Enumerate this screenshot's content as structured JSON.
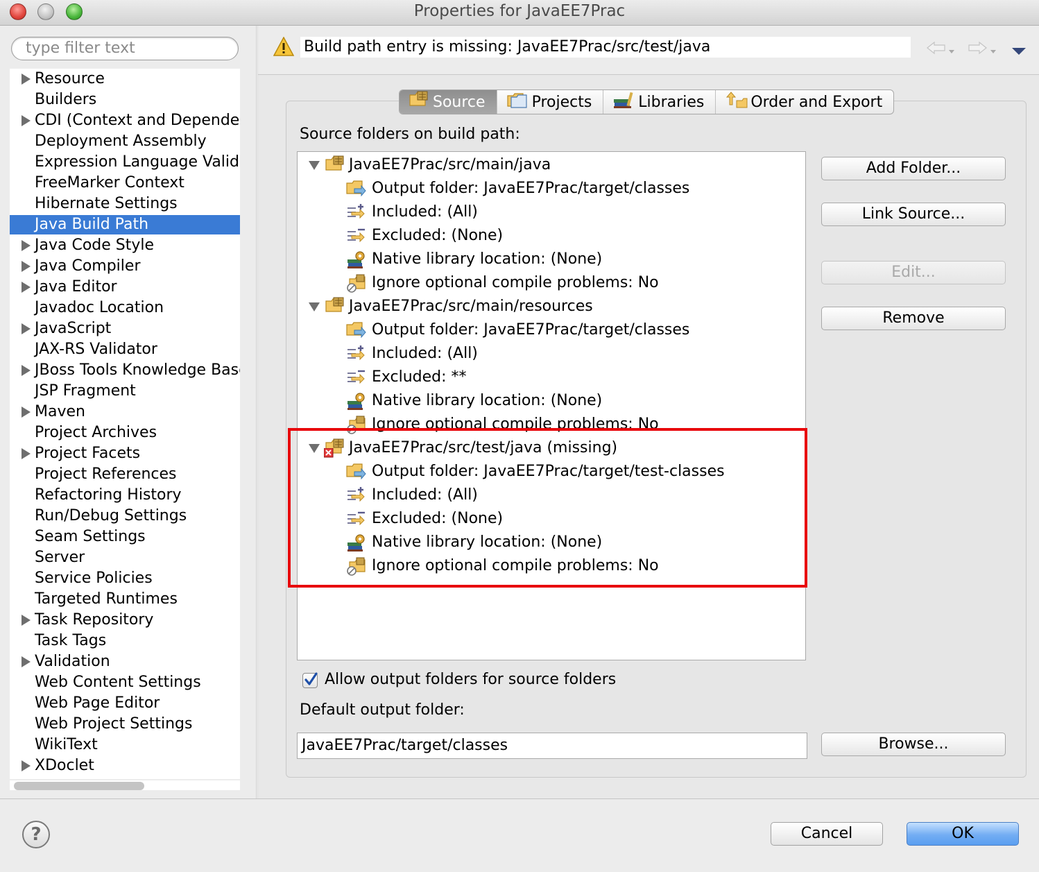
{
  "window": {
    "title": "Properties for JavaEE7Prac"
  },
  "filter": {
    "placeholder": "type filter text"
  },
  "nav_tree": [
    {
      "label": "Resource",
      "expandable": true
    },
    {
      "label": "Builders",
      "expandable": false
    },
    {
      "label": "CDI (Context and Dependen",
      "expandable": true
    },
    {
      "label": "Deployment Assembly",
      "expandable": false
    },
    {
      "label": "Expression Language Valida",
      "expandable": false
    },
    {
      "label": "FreeMarker Context",
      "expandable": false
    },
    {
      "label": "Hibernate Settings",
      "expandable": false
    },
    {
      "label": "Java Build Path",
      "expandable": false,
      "selected": true
    },
    {
      "label": "Java Code Style",
      "expandable": true
    },
    {
      "label": "Java Compiler",
      "expandable": true
    },
    {
      "label": "Java Editor",
      "expandable": true
    },
    {
      "label": "Javadoc Location",
      "expandable": false
    },
    {
      "label": "JavaScript",
      "expandable": true
    },
    {
      "label": "JAX-RS Validator",
      "expandable": false
    },
    {
      "label": "JBoss Tools Knowledge Base",
      "expandable": true
    },
    {
      "label": "JSP Fragment",
      "expandable": false
    },
    {
      "label": "Maven",
      "expandable": true
    },
    {
      "label": "Project Archives",
      "expandable": false
    },
    {
      "label": "Project Facets",
      "expandable": true
    },
    {
      "label": "Project References",
      "expandable": false
    },
    {
      "label": "Refactoring History",
      "expandable": false
    },
    {
      "label": "Run/Debug Settings",
      "expandable": false
    },
    {
      "label": "Seam Settings",
      "expandable": false
    },
    {
      "label": "Server",
      "expandable": false
    },
    {
      "label": "Service Policies",
      "expandable": false
    },
    {
      "label": "Targeted Runtimes",
      "expandable": false
    },
    {
      "label": "Task Repository",
      "expandable": true
    },
    {
      "label": "Task Tags",
      "expandable": false
    },
    {
      "label": "Validation",
      "expandable": true
    },
    {
      "label": "Web Content Settings",
      "expandable": false
    },
    {
      "label": "Web Page Editor",
      "expandable": false
    },
    {
      "label": "Web Project Settings",
      "expandable": false
    },
    {
      "label": "WikiText",
      "expandable": false
    },
    {
      "label": "XDoclet",
      "expandable": true
    }
  ],
  "message": {
    "text": "Build path entry is missing: JavaEE7Prac/src/test/java",
    "icon": "warning-icon"
  },
  "tabs": [
    {
      "label": "Source",
      "icon": "source-folder-icon",
      "active": true
    },
    {
      "label": "Projects",
      "icon": "projects-icon",
      "active": false
    },
    {
      "label": "Libraries",
      "icon": "libraries-icon",
      "active": false
    },
    {
      "label": "Order and Export",
      "icon": "order-export-icon",
      "active": false
    }
  ],
  "source": {
    "label": "Source folders on build path:",
    "folders": [
      {
        "name": "JavaEE7Prac/src/main/java",
        "missing": false,
        "children": [
          {
            "text": "Output folder: JavaEE7Prac/target/classes",
            "icon": "output-folder-icon"
          },
          {
            "text": "Included: (All)",
            "icon": "included-icon"
          },
          {
            "text": "Excluded: (None)",
            "icon": "excluded-icon"
          },
          {
            "text": "Native library location: (None)",
            "icon": "native-library-icon"
          },
          {
            "text": "Ignore optional compile problems: No",
            "icon": "ignore-problems-icon"
          }
        ]
      },
      {
        "name": "JavaEE7Prac/src/main/resources",
        "missing": false,
        "children": [
          {
            "text": "Output folder: JavaEE7Prac/target/classes",
            "icon": "output-folder-icon"
          },
          {
            "text": "Included: (All)",
            "icon": "included-icon"
          },
          {
            "text": "Excluded: **",
            "icon": "excluded-icon"
          },
          {
            "text": "Native library location: (None)",
            "icon": "native-library-icon"
          },
          {
            "text": "Ignore optional compile problems: No",
            "icon": "ignore-problems-icon"
          }
        ]
      },
      {
        "name": "JavaEE7Prac/src/test/java (missing)",
        "missing": true,
        "children": [
          {
            "text": "Output folder: JavaEE7Prac/target/test-classes",
            "icon": "output-folder-icon"
          },
          {
            "text": "Included: (All)",
            "icon": "included-icon"
          },
          {
            "text": "Excluded: (None)",
            "icon": "excluded-icon"
          },
          {
            "text": "Native library location: (None)",
            "icon": "native-library-icon"
          },
          {
            "text": "Ignore optional compile problems: No",
            "icon": "ignore-problems-icon"
          }
        ]
      }
    ]
  },
  "buttons": {
    "add_folder": "Add Folder...",
    "link_source": "Link Source...",
    "edit": "Edit...",
    "remove": "Remove",
    "browse": "Browse..."
  },
  "allow_output": {
    "label": "Allow output folders for source folders",
    "checked": true
  },
  "default_output": {
    "label": "Default output folder:",
    "value": "JavaEE7Prac/target/classes"
  },
  "dialog": {
    "cancel": "Cancel",
    "ok": "OK",
    "help": "?"
  },
  "colors": {
    "selection": "#3a7bd5",
    "highlight": "#e8050a",
    "ok_button": "#73adf3"
  }
}
